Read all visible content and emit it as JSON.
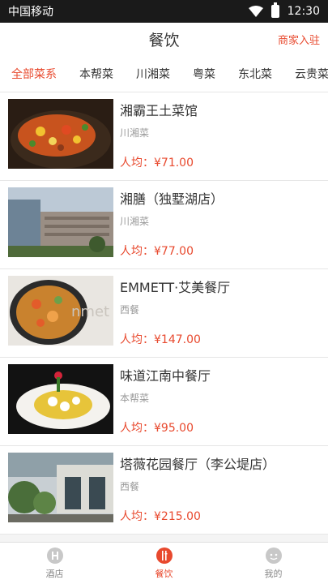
{
  "status_bar": {
    "carrier": "中国移动",
    "time": "12:30"
  },
  "header": {
    "title": "餐饮",
    "merchant_link": "商家入驻"
  },
  "categories": [
    "全部菜系",
    "本帮菜",
    "川湘菜",
    "粤菜",
    "东北菜",
    "云贵菜"
  ],
  "active_category": "全部菜系",
  "restaurants": [
    {
      "name": "湘霸王土菜馆",
      "cuisine": "川湘菜",
      "price": "人均：¥71.00"
    },
    {
      "name": "湘膳（独墅湖店）",
      "cuisine": "川湘菜",
      "price": "人均：¥77.00"
    },
    {
      "name": "EMMETT·艾美餐厅",
      "cuisine": "西餐",
      "price": "人均：¥147.00"
    },
    {
      "name": "味道江南中餐厅",
      "cuisine": "本帮菜",
      "price": "人均：¥95.00"
    },
    {
      "name": "塔薇花园餐厅（李公堤店）",
      "cuisine": "西餐",
      "price": "人均：¥215.00"
    }
  ],
  "tab_bar": {
    "items": [
      "酒店",
      "餐饮",
      "我的"
    ],
    "active": "餐饮"
  },
  "colors": {
    "accent": "#e8492e",
    "text": "#333333",
    "muted": "#999999"
  }
}
